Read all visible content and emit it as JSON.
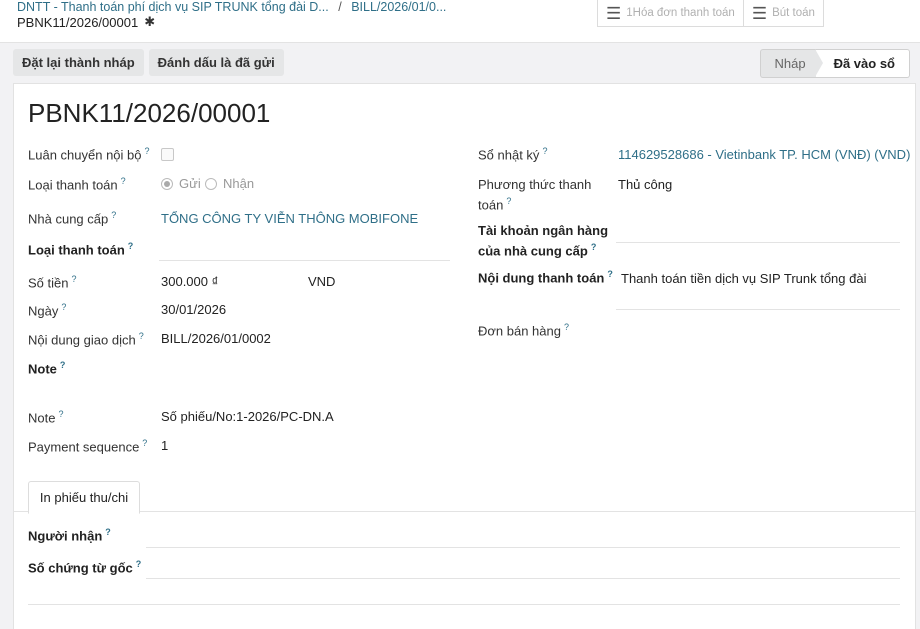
{
  "breadcrumb": {
    "parent": "DNTT - Thanh toán phí dịch vụ SIP TRUNK tổng đài D...",
    "separator": "/",
    "current": "BILL/2026/01/0..."
  },
  "record": {
    "name": "PBNK11/2026/00001"
  },
  "smart_buttons": [
    {
      "label": "1Hóa đơn thanh toán",
      "icon": "list-icon"
    },
    {
      "label": "Bút toán",
      "icon": "list-icon"
    }
  ],
  "actions": {
    "reset_label": "Đặt lại thành nháp",
    "mark_sent_label": "Đánh dấu là đã gửi"
  },
  "status": {
    "draft": "Nháp",
    "posted": "Đã vào sổ"
  },
  "form": {
    "title": "PBNK11/2026/00001",
    "help_mark": "?",
    "internal_transfer_label": "Luân chuyển nội bộ",
    "payment_type_label": "Loại thanh toán",
    "payment_type_send": "Gửi",
    "payment_type_receive": "Nhận",
    "vendor_label": "Nhà cung cấp",
    "vendor_value": "TỔNG CÔNG TY VIỄN THÔNG MOBIFONE",
    "payment_type2_label": "Loại thanh toán",
    "amount_label": "Số tiền",
    "amount_value": "300.000 ₫",
    "currency_value": "VND",
    "date_label": "Ngày",
    "date_value": "30/01/2026",
    "memo_label": "Nội dung giao dịch",
    "memo_value": "BILL/2026/01/0002",
    "note_heading": "Note",
    "note_label": "Note",
    "note_value": "Số phiếu/No:1-2026/PC-DN.A",
    "sequence_label": "Payment sequence",
    "sequence_value": "1",
    "journal_label": "Sổ nhật ký",
    "journal_value": "114629528686 - Vietinbank TP. HCM (VNĐ) (VND)",
    "method_label": "Phương thức thanh toán",
    "method_value": "Thủ công",
    "bank_label": "Tài khoản ngân hàng của nhà cung cấp",
    "content_label": "Nội dung thanh toán",
    "content_value": "Thanh toán tiền dịch vụ SIP Trunk tổng đài",
    "sale_order_label": "Đơn bán hàng"
  },
  "tabs": {
    "print_label": "In phiếu thu/chi"
  },
  "print_tab": {
    "receiver_label": "Người nhận",
    "original_doc_label": "Số chứng từ gốc"
  }
}
